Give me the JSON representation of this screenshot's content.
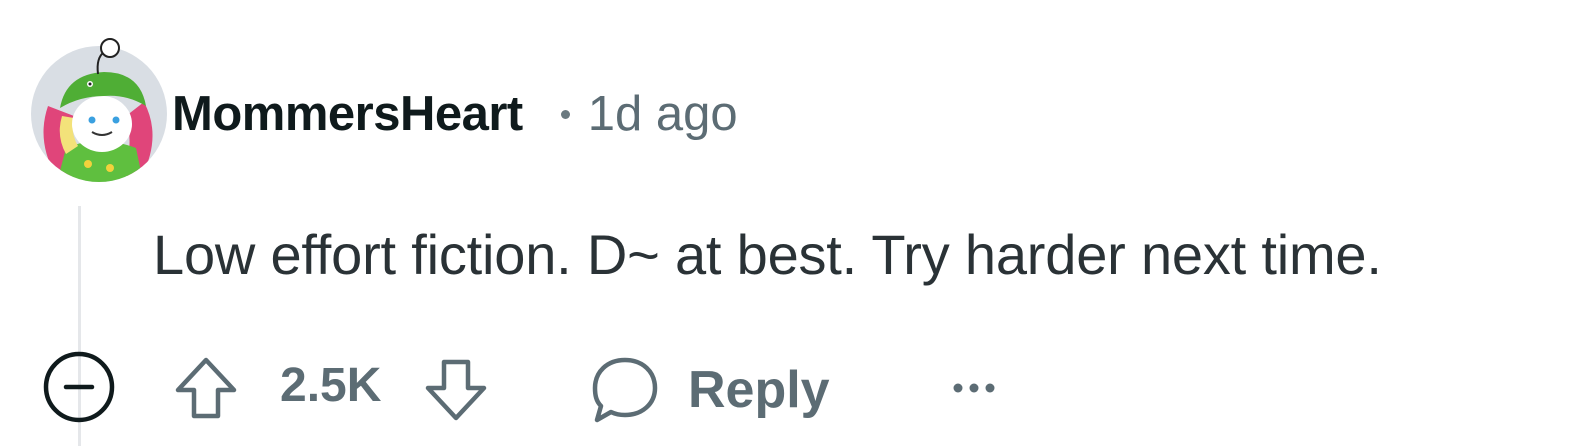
{
  "comment": {
    "username": "MommersHeart",
    "timestamp": "1d ago",
    "body": "Low effort fiction. D~ at best. Try harder next time.",
    "score": "2.5K",
    "reply_label": "Reply"
  },
  "icons": {
    "avatar": "avatar-icon",
    "collapse": "collapse-minus-icon",
    "upvote": "upvote-arrow-icon",
    "downvote": "downvote-arrow-icon",
    "reply": "speech-bubble-icon",
    "more": "more-dots-icon"
  },
  "colors": {
    "username": "#0f1a1c",
    "meta": "#5c6c74",
    "body": "#2a3236",
    "thread_line": "#e5e7ea"
  }
}
